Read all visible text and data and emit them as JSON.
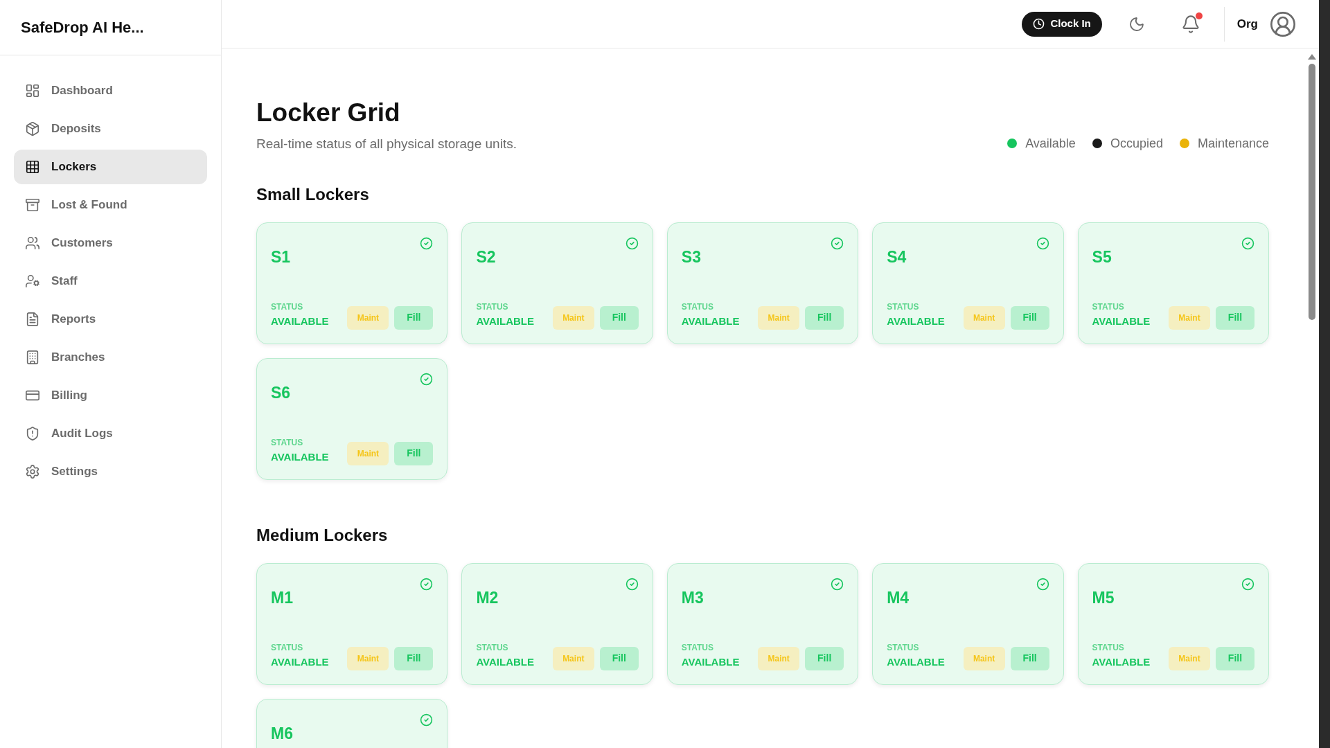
{
  "sidebar": {
    "brand": "SafeDrop AI He...",
    "items": [
      {
        "label": "Dashboard",
        "selected": false
      },
      {
        "label": "Deposits",
        "selected": false
      },
      {
        "label": "Lockers",
        "selected": true
      },
      {
        "label": "Lost & Found",
        "selected": false
      },
      {
        "label": "Customers",
        "selected": false
      },
      {
        "label": "Staff",
        "selected": false
      },
      {
        "label": "Reports",
        "selected": false
      },
      {
        "label": "Branches",
        "selected": false
      },
      {
        "label": "Billing",
        "selected": false
      },
      {
        "label": "Audit Logs",
        "selected": false
      },
      {
        "label": "Settings",
        "selected": false
      }
    ]
  },
  "header": {
    "clock_in": "Clock In",
    "has_notification": true,
    "org": "Org"
  },
  "page": {
    "title": "Locker Grid",
    "subtitle": "Real-time status of all physical storage units.",
    "legend": [
      {
        "label": "Available",
        "color": "#16c55e"
      },
      {
        "label": "Occupied",
        "color": "#1a1a1a"
      },
      {
        "label": "Maintenance",
        "color": "#eab308"
      }
    ]
  },
  "sections": [
    {
      "title": "Small Lockers",
      "lockers": [
        {
          "name": "S1",
          "kind": "available",
          "status_label": "STATUS",
          "status": "AVAILABLE",
          "buttons": [
            "Maint",
            "Fill"
          ]
        },
        {
          "name": "S2",
          "kind": "available",
          "status_label": "STATUS",
          "status": "AVAILABLE",
          "buttons": [
            "Maint",
            "Fill"
          ]
        },
        {
          "name": "S3",
          "kind": "available",
          "status_label": "STATUS",
          "status": "AVAILABLE",
          "buttons": [
            "Maint",
            "Fill"
          ]
        },
        {
          "name": "S4",
          "kind": "available",
          "status_label": "STATUS",
          "status": "AVAILABLE",
          "buttons": [
            "Maint",
            "Fill"
          ]
        },
        {
          "name": "S5",
          "kind": "available",
          "status_label": "STATUS",
          "status": "AVAILABLE",
          "buttons": [
            "Maint",
            "Fill"
          ]
        },
        {
          "name": "S6",
          "kind": "available",
          "status_label": "STATUS",
          "status": "AVAILABLE",
          "buttons": [
            "Maint",
            "Fill"
          ]
        }
      ]
    },
    {
      "title": "Medium Lockers",
      "lockers": [
        {
          "name": "M1",
          "kind": "available",
          "status_label": "STATUS",
          "status": "AVAILABLE",
          "buttons": [
            "Maint",
            "Fill"
          ]
        },
        {
          "name": "M2",
          "kind": "available",
          "status_label": "STATUS",
          "status": "AVAILABLE",
          "buttons": [
            "Maint",
            "Fill"
          ]
        },
        {
          "name": "M3",
          "kind": "available",
          "status_label": "STATUS",
          "status": "AVAILABLE",
          "buttons": [
            "Maint",
            "Fill"
          ]
        },
        {
          "name": "M4",
          "kind": "available",
          "status_label": "STATUS",
          "status": "AVAILABLE",
          "buttons": [
            "Maint",
            "Fill"
          ]
        },
        {
          "name": "M5",
          "kind": "available",
          "status_label": "STATUS",
          "status": "AVAILABLE",
          "buttons": [
            "Maint",
            "Fill"
          ]
        },
        {
          "name": "M6",
          "kind": "available"
        }
      ]
    }
  ]
}
